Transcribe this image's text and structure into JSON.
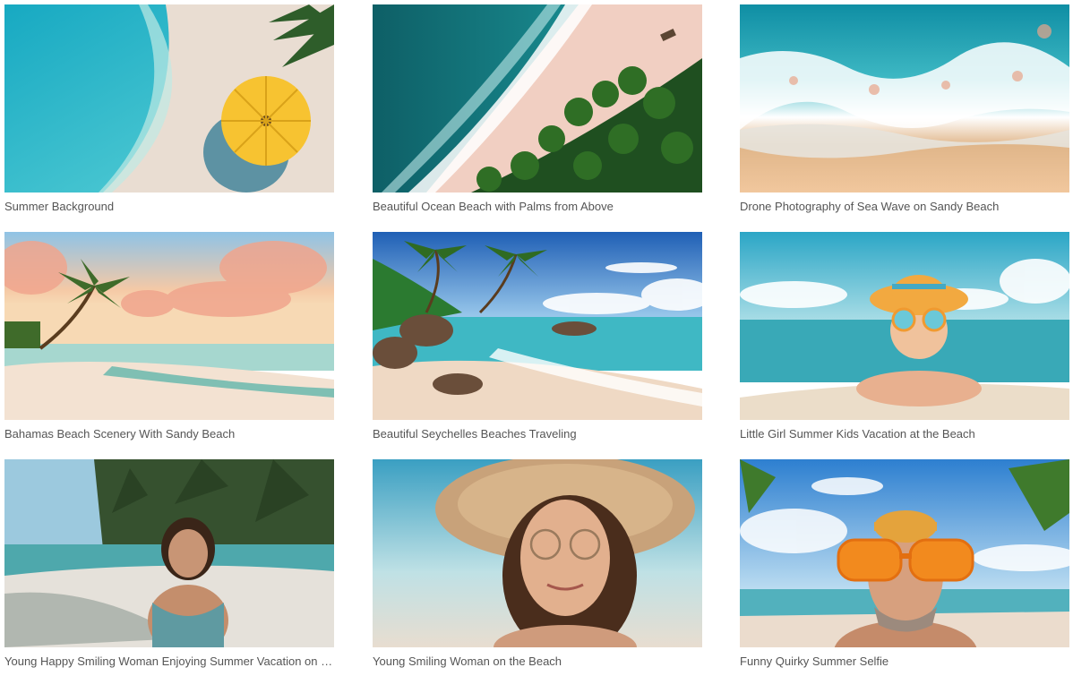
{
  "gallery": {
    "items": [
      {
        "title": "Summer Background",
        "icon": "beach-umbrella-aerial"
      },
      {
        "title": "Beautiful Ocean Beach with Palms from Above",
        "icon": "ocean-palms-aerial"
      },
      {
        "title": "Drone Photography of Sea Wave on Sandy Beach",
        "icon": "sea-wave-aerial"
      },
      {
        "title": "Bahamas Beach Scenery With Sandy Beach",
        "icon": "sunset-palm-beach"
      },
      {
        "title": "Beautiful Seychelles Beaches Traveling",
        "icon": "seychelles-beach"
      },
      {
        "title": "Little Girl Summer Kids Vacation at the Beach",
        "icon": "girl-sunglasses-beach"
      },
      {
        "title": "Young Happy Smiling Woman Enjoying Summer Vacation on a Tropical Beach",
        "icon": "woman-tropical-beach"
      },
      {
        "title": "Young Smiling Woman on the Beach",
        "icon": "woman-straw-hat"
      },
      {
        "title": "Funny Quirky Summer Selfie",
        "icon": "man-orange-glasses-selfie"
      }
    ]
  }
}
